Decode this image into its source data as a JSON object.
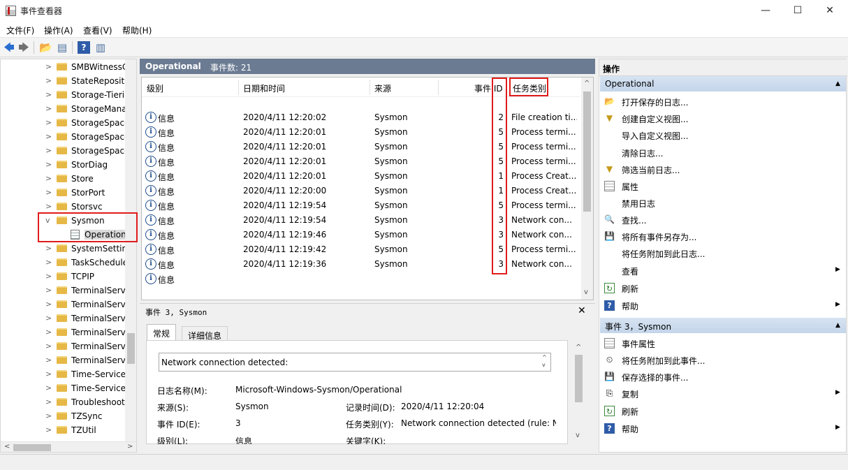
{
  "window": {
    "title": "事件查看器",
    "minimize": "—",
    "maximize": "☐",
    "close": "✕"
  },
  "menu": [
    "文件(F)",
    "操作(A)",
    "查看(V)",
    "帮助(H)"
  ],
  "toolbar": {
    "back": "🡄",
    "forward": "🡆",
    "up": "📂",
    "scope": "▤",
    "help": "?",
    "show": "▥"
  },
  "tree": {
    "items": [
      "SMBWitnessC",
      "StateReposito",
      "Storage-Tieri",
      "StorageMana",
      "StorageSpace",
      "StorageSpace",
      "StorageSpace",
      "StorDiag",
      "Store",
      "StorPort",
      "Storsvc",
      "Sysmon",
      "SystemSetting",
      "TaskSchedule",
      "TCPIP",
      "TerminalServ",
      "TerminalServ",
      "TerminalServ",
      "TerminalServ",
      "TerminalServ",
      "TerminalServ",
      "Time-Service",
      "Time-Service-",
      "Troubleshoot",
      "TZSync",
      "TZUtil"
    ],
    "expanded": "Sysmon",
    "child": "Operational",
    "scroll_left": "<",
    "scroll_right": ">"
  },
  "log": {
    "name": "Operational",
    "count_label": "事件数: 21",
    "columns": {
      "level": "级别",
      "date": "日期和时间",
      "source": "来源",
      "event_id": "事件 ID",
      "task": "任务类别"
    },
    "rows": [
      {
        "level": "信息",
        "date": "2020/4/11 12:20:02",
        "source": "Sysmon",
        "id": "2",
        "task": "File creation ti..."
      },
      {
        "level": "信息",
        "date": "2020/4/11 12:20:01",
        "source": "Sysmon",
        "id": "5",
        "task": "Process termi..."
      },
      {
        "level": "信息",
        "date": "2020/4/11 12:20:01",
        "source": "Sysmon",
        "id": "5",
        "task": "Process termi..."
      },
      {
        "level": "信息",
        "date": "2020/4/11 12:20:01",
        "source": "Sysmon",
        "id": "5",
        "task": "Process termi..."
      },
      {
        "level": "信息",
        "date": "2020/4/11 12:20:01",
        "source": "Sysmon",
        "id": "1",
        "task": "Process Creat..."
      },
      {
        "level": "信息",
        "date": "2020/4/11 12:20:00",
        "source": "Sysmon",
        "id": "1",
        "task": "Process Creat..."
      },
      {
        "level": "信息",
        "date": "2020/4/11 12:19:54",
        "source": "Sysmon",
        "id": "5",
        "task": "Process termi..."
      },
      {
        "level": "信息",
        "date": "2020/4/11 12:19:54",
        "source": "Sysmon",
        "id": "3",
        "task": "Network con..."
      },
      {
        "level": "信息",
        "date": "2020/4/11 12:19:46",
        "source": "Sysmon",
        "id": "3",
        "task": "Network con..."
      },
      {
        "level": "信息",
        "date": "2020/4/11 12:19:42",
        "source": "Sysmon",
        "id": "5",
        "task": "Process termi..."
      },
      {
        "level": "信息",
        "date": "2020/4/11 12:19:36",
        "source": "Sysmon",
        "id": "3",
        "task": "Network con..."
      },
      {
        "level": "信息",
        "date": "",
        "source": "",
        "id": "",
        "task": ""
      }
    ]
  },
  "detail": {
    "title": "事件 3, Sysmon",
    "close": "✕",
    "tabs": [
      "常规",
      "详细信息"
    ],
    "description": "Network connection detected:",
    "fields": {
      "log_name_label": "日志名称(M):",
      "log_name": "Microsoft-Windows-Sysmon/Operational",
      "source_label": "来源(S):",
      "source": "Sysmon",
      "logged_label": "记录时间(D):",
      "logged": "2020/4/11 12:20:04",
      "event_id_label": "事件 ID(E):",
      "event_id": "3",
      "task_label": "任务类别(Y):",
      "task": "Network connection detected (rule: Ne",
      "level_label": "级别(L):",
      "level": "信息",
      "keywords_label": "关键字(K):"
    }
  },
  "actions": {
    "header": "操作",
    "section1": "Operational",
    "section1_items": [
      {
        "icon": "open-folder-icon",
        "glyph": "📂",
        "label": "打开保存的日志..."
      },
      {
        "icon": "create-view-icon",
        "glyph": "▼",
        "label": "创建自定义视图..."
      },
      {
        "icon": "",
        "glyph": "",
        "label": "导入自定义视图..."
      },
      {
        "icon": "",
        "glyph": "",
        "label": "清除日志..."
      },
      {
        "icon": "filter-icon",
        "glyph": "▼",
        "label": "筛选当前日志..."
      },
      {
        "icon": "properties-icon",
        "glyph": "",
        "label": "属性"
      },
      {
        "icon": "",
        "glyph": "",
        "label": "禁用日志"
      },
      {
        "icon": "find-icon",
        "glyph": "🔍",
        "label": "查找..."
      },
      {
        "icon": "save-icon",
        "glyph": "💾",
        "label": "将所有事件另存为..."
      },
      {
        "icon": "",
        "glyph": "",
        "label": "将任务附加到此日志..."
      },
      {
        "icon": "",
        "glyph": "",
        "label": "查看",
        "submenu": "▶"
      },
      {
        "icon": "refresh-icon",
        "glyph": "↻",
        "label": "刷新"
      },
      {
        "icon": "help-icon",
        "glyph": "?",
        "label": "帮助",
        "submenu": "▶"
      }
    ],
    "section2": "事件 3，Sysmon",
    "section2_items": [
      {
        "icon": "event-properties-icon",
        "glyph": "",
        "label": "事件属性"
      },
      {
        "icon": "attach-task-icon",
        "glyph": "⏲",
        "label": "将任务附加到此事件..."
      },
      {
        "icon": "save-icon",
        "glyph": "💾",
        "label": "保存选择的事件..."
      },
      {
        "icon": "copy-icon",
        "glyph": "⎘",
        "label": "复制",
        "submenu": "▶"
      },
      {
        "icon": "refresh-icon",
        "glyph": "↻",
        "label": "刷新"
      },
      {
        "icon": "help-icon",
        "glyph": "?",
        "label": "帮助",
        "submenu": "▶"
      }
    ],
    "collapse": "▲"
  },
  "colors": {
    "accent_header": "#6b7b92",
    "section_header": "#c4d5ea",
    "highlight": "#e01b1b"
  }
}
